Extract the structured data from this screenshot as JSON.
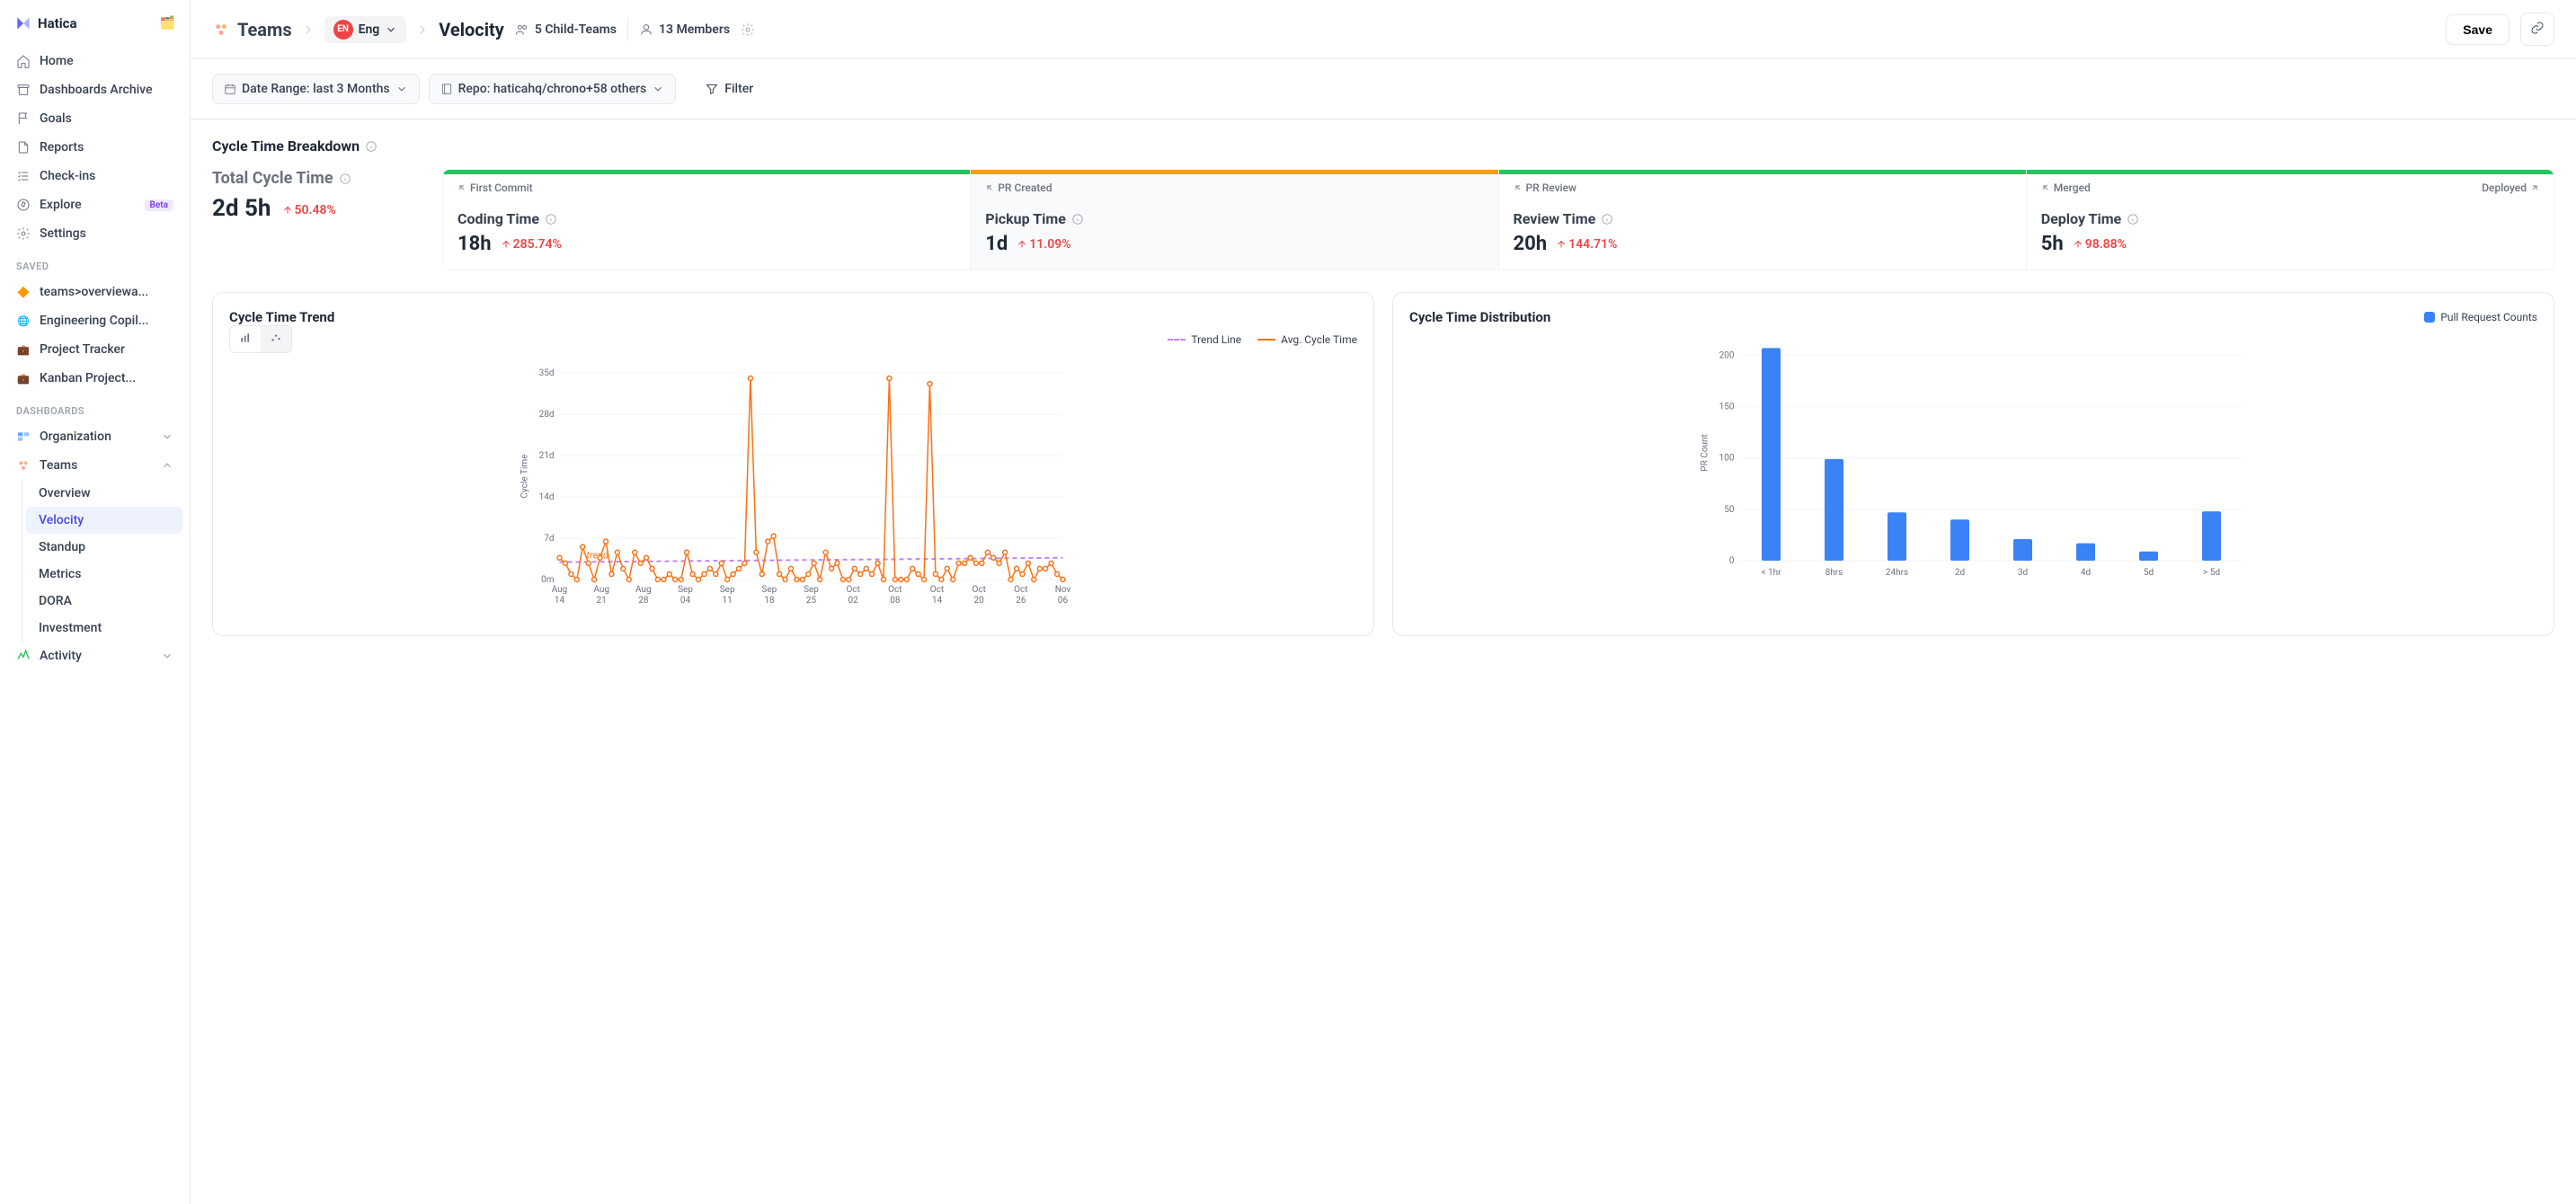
{
  "brand": "Hatica",
  "nav": {
    "items": [
      {
        "icon": "home",
        "label": "Home"
      },
      {
        "icon": "archive",
        "label": "Dashboards Archive"
      },
      {
        "icon": "flag",
        "label": "Goals"
      },
      {
        "icon": "file",
        "label": "Reports"
      },
      {
        "icon": "check",
        "label": "Check-ins"
      },
      {
        "icon": "compass",
        "label": "Explore",
        "badge": "Beta"
      },
      {
        "icon": "gear",
        "label": "Settings"
      }
    ],
    "saved_label": "SAVED",
    "saved": [
      {
        "label": "teams>overviewa...",
        "ico": "🔶"
      },
      {
        "label": "Engineering Copil...",
        "ico": "🌐"
      },
      {
        "label": "Project Tracker",
        "ico": "💼"
      },
      {
        "label": "Kanban Project...",
        "ico": "💼"
      }
    ],
    "dash_label": "DASHBOARDS",
    "dash": [
      {
        "label": "Organization",
        "expanded": false
      },
      {
        "label": "Teams",
        "expanded": true,
        "children": [
          "Overview",
          "Velocity",
          "Standup",
          "Metrics",
          "DORA",
          "Investment"
        ],
        "active": "Velocity"
      },
      {
        "label": "Activity",
        "expanded": false
      }
    ]
  },
  "header": {
    "teams_label": "Teams",
    "eng_short": "EN",
    "eng_label": "Eng",
    "page_title": "Velocity",
    "child_teams": "5 Child-Teams",
    "members": "13 Members",
    "save_label": "Save"
  },
  "filters": {
    "date_range": "Date Range: last 3 Months",
    "repo": "Repo: haticahq/chrono+58 others",
    "filter_label": "Filter"
  },
  "cycle": {
    "title": "Cycle Time Breakdown",
    "total_label": "Total Cycle Time",
    "total_value": "2d 5h",
    "total_delta": "50.48%",
    "stages": [
      {
        "bar": "green",
        "start": "First Commit",
        "title": "Coding Time",
        "value": "18h",
        "delta": "285.74%"
      },
      {
        "bar": "orange",
        "start": "PR Created",
        "title": "Pickup Time",
        "value": "1d",
        "delta": "11.09%",
        "selected": true
      },
      {
        "bar": "green",
        "start": "PR Review",
        "title": "Review Time",
        "value": "20h",
        "delta": "144.71%"
      },
      {
        "bar": "green",
        "start": "Merged",
        "end": "Deployed",
        "title": "Deploy Time",
        "value": "5h",
        "delta": "98.88%"
      }
    ]
  },
  "chart1": {
    "title": "Cycle Time Trend",
    "legend_trend": "Trend Line",
    "legend_avg": "Avg. Cycle Time",
    "trend_annotation": "trend",
    "ylabel": "Cycle Time"
  },
  "chart2": {
    "title": "Cycle Time Distribution",
    "legend": "Pull Request Counts",
    "ylabel": "PR Count"
  },
  "chart_data": [
    {
      "type": "line",
      "title": "Cycle Time Trend",
      "xlabel": "",
      "ylabel": "Cycle Time",
      "ylim": [
        0,
        38
      ],
      "y_ticks": [
        "0m",
        "7d",
        "14d",
        "21d",
        "28d",
        "35d"
      ],
      "x_ticks": [
        "Aug 14",
        "Aug 21",
        "Aug 28",
        "Sep 04",
        "Sep 11",
        "Sep 18",
        "Sep 25",
        "Oct 02",
        "Oct 08",
        "Oct 14",
        "Oct 20",
        "Oct 26",
        "Nov 06"
      ],
      "series": [
        {
          "name": "Avg. Cycle Time",
          "color": "#f97316",
          "values_days": [
            4,
            3,
            1,
            0,
            6,
            3,
            0,
            4,
            7,
            1,
            5,
            2,
            0,
            5,
            3,
            4,
            2,
            0,
            0,
            1,
            0,
            0,
            5,
            1,
            0,
            1,
            2,
            1,
            3,
            0,
            1,
            2,
            3,
            37,
            5,
            1,
            7,
            8,
            1,
            0,
            2,
            0,
            0,
            1,
            3,
            0,
            5,
            2,
            3,
            0,
            0,
            2,
            1,
            2,
            1,
            3,
            0,
            37,
            0,
            0,
            0,
            2,
            1,
            0,
            36,
            1,
            0,
            2,
            0,
            3,
            3,
            4,
            3,
            3,
            5,
            4,
            3,
            5,
            0,
            2,
            1,
            3,
            0,
            2,
            2,
            3,
            1,
            0
          ]
        },
        {
          "name": "Trend Line",
          "color": "#c084fc",
          "style": "dashed",
          "values_days": [
            3.2,
            4.0
          ]
        }
      ]
    },
    {
      "type": "bar",
      "title": "Cycle Time Distribution",
      "xlabel": "",
      "ylabel": "PR Count",
      "ylim": [
        0,
        210
      ],
      "y_ticks": [
        0,
        50,
        100,
        150,
        200
      ],
      "categories": [
        "< 1hr",
        "8hrs",
        "24hrs",
        "2d",
        "3d",
        "4d",
        "5d",
        "> 5d"
      ],
      "values": [
        207,
        99,
        47,
        40,
        21,
        17,
        9,
        48
      ],
      "color": "#3b82f6"
    }
  ]
}
